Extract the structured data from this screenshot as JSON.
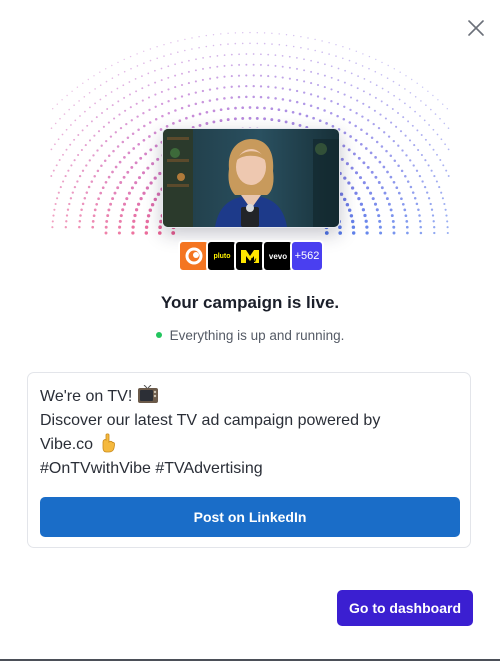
{
  "dialog": {
    "close_icon": "close-icon"
  },
  "hero": {
    "video_thumbnail": "woman-presenter-video-thumbnail",
    "channels": [
      {
        "name": "crunchyroll-logo",
        "label": "",
        "color": "#f47521"
      },
      {
        "name": "pluto-logo",
        "label": "pluto",
        "color": "#000000"
      },
      {
        "name": "mtv-logo",
        "label": "M",
        "color": "#000000"
      },
      {
        "name": "vevo-logo",
        "label": "vevo",
        "color": "#000000"
      }
    ],
    "more_channels": "+562"
  },
  "headline": "Your campaign is live.",
  "status": {
    "text": "Everything is up and running.",
    "dot_color": "#22c55e"
  },
  "post": {
    "line1": "We're on TV!",
    "line1_icon": "television-emoji",
    "line2": "Discover our latest TV ad campaign powered by",
    "line3": "Vibe.co",
    "line3_icon": "pointing-down-emoji",
    "line4": "#OnTVwithVibe #TVAdvertising",
    "button_label": "Post on LinkedIn",
    "button_color": "#1a6dc8"
  },
  "footer": {
    "dashboard_label": "Go to dashboard",
    "dashboard_color": "#3b1fd1"
  }
}
